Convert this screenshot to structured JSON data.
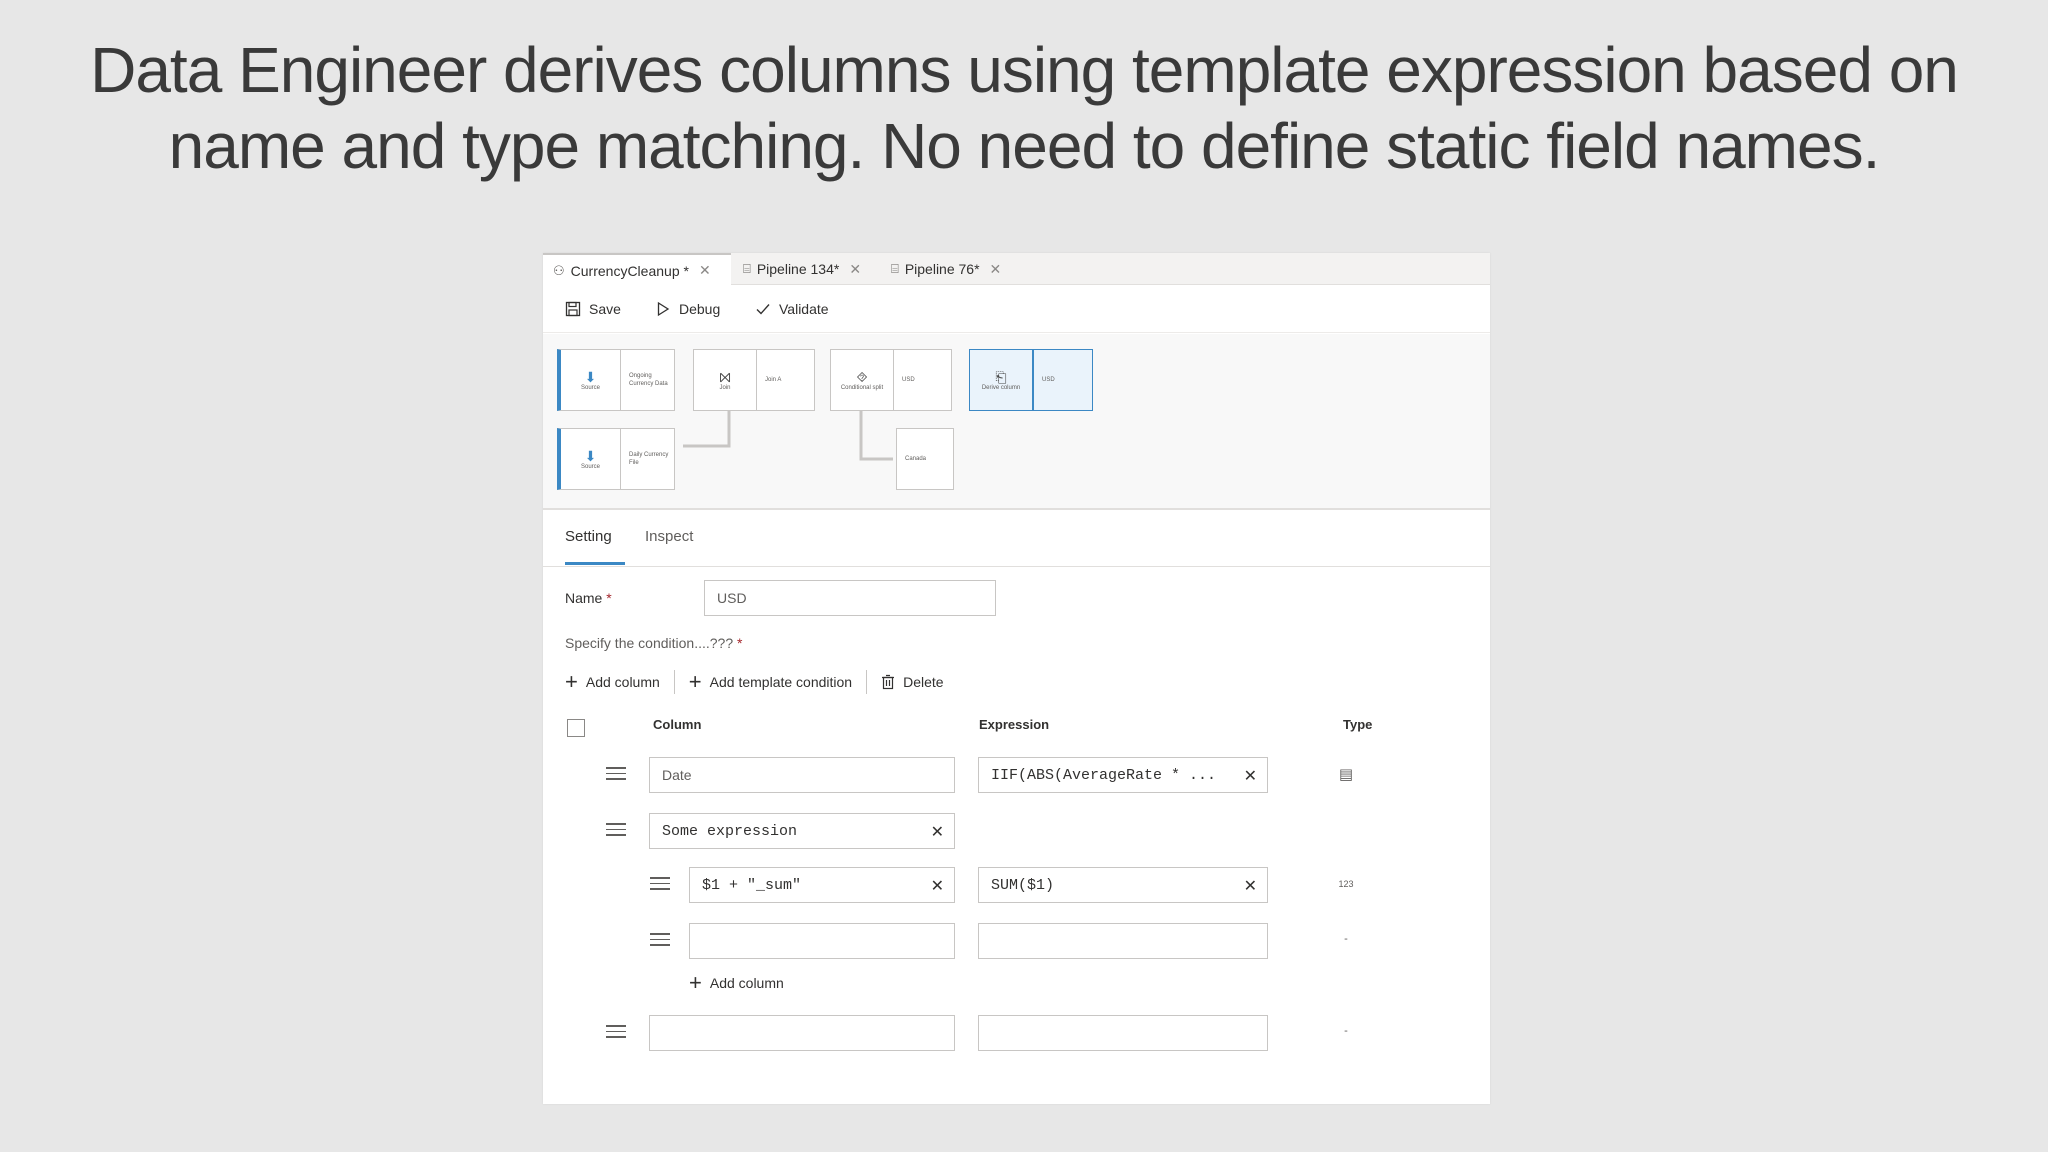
{
  "headline": {
    "line1": "Data Engineer derives columns using template expression based on",
    "line2": "name and type matching. No need to define static field names."
  },
  "tabs": [
    {
      "label": "CurrencyCleanup *",
      "icon": "dataflow-icon",
      "active": true
    },
    {
      "label": "Pipeline 134*",
      "icon": "pipeline-icon",
      "active": false
    },
    {
      "label": "Pipeline 76*",
      "icon": "pipeline-icon",
      "active": false
    }
  ],
  "toolbar": {
    "save_label": "Save",
    "debug_label": "Debug",
    "validate_label": "Validate"
  },
  "canvas": {
    "row1": [
      {
        "node": "Source",
        "label": "Ongoing Currency Data"
      },
      {
        "node": "Join",
        "label": "Join A"
      },
      {
        "node": "Conditional split",
        "label": "USD"
      },
      {
        "node": "Derive column",
        "label": "USD"
      }
    ],
    "row2": [
      {
        "node": "Source",
        "label": "Daily Currency File"
      },
      {
        "node": "",
        "label": "Canada"
      }
    ]
  },
  "settings": {
    "tab_setting": "Setting",
    "tab_inspect": "Inspect",
    "name_label": "Name",
    "name_required": "*",
    "name_value": "USD",
    "condition_label": "Specify the condition....???",
    "condition_required": "*"
  },
  "actions": {
    "add_column": "Add column",
    "add_template": "Add template condition",
    "delete": "Delete"
  },
  "grid": {
    "col_column": "Column",
    "col_expression": "Expression",
    "col_type": "Type",
    "rows": [
      {
        "column_placeholder": "Date",
        "expression": "IIF(ABS(AverageRate *  ...",
        "type_icon": "calendar-icon"
      },
      {
        "column": "Some expression"
      },
      {
        "column": "$1 + \"_sum\"",
        "expression": "SUM($1)",
        "type": "123"
      },
      {
        "column": "",
        "expression": "",
        "type": "-"
      },
      {
        "column": "",
        "expression": "",
        "type": "-"
      }
    ],
    "add_column_nested": "Add column"
  }
}
